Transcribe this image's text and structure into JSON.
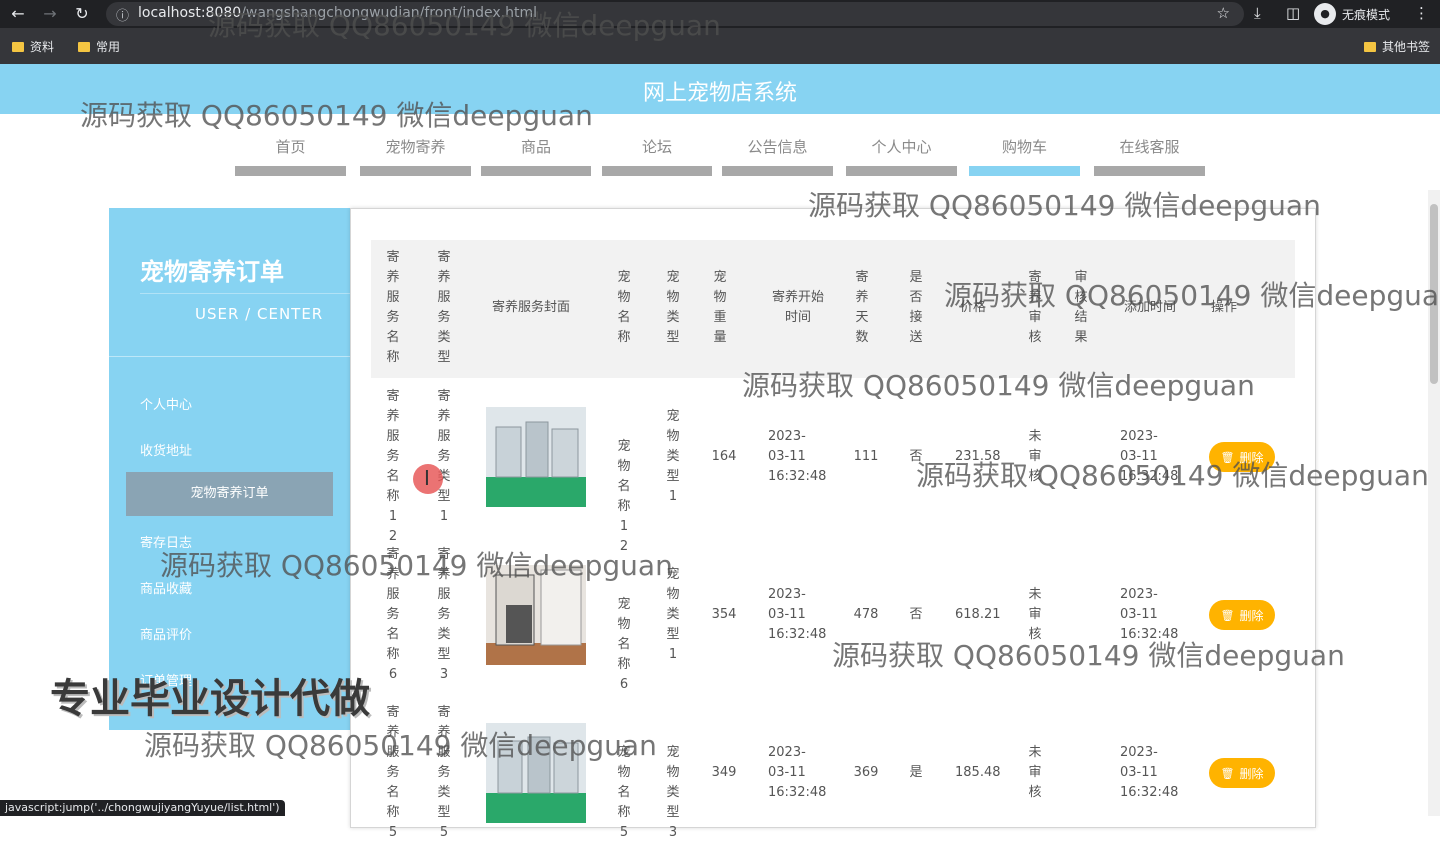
{
  "browser": {
    "url_host": "localhost:8080",
    "url_path": "/wangshangchongwudian/front/index.html",
    "incognito_label": "无痕模式",
    "bookmarks": [
      "资料",
      "常用"
    ],
    "other_bookmarks": "其他书签",
    "status_url": "javascript:jump('../chongwujiyangYuyue/list.html')"
  },
  "site": {
    "title": "网上宠物店系统",
    "nav": [
      "首页",
      "宠物寄养",
      "商品",
      "论坛",
      "公告信息",
      "个人中心",
      "购物车",
      "在线客服"
    ],
    "active_nav": "购物车"
  },
  "sidebar": {
    "title": "宠物寄养订单",
    "subtitle": "USER / CENTER",
    "items": [
      "个人中心",
      "收货地址",
      "宠物寄养订单",
      "寄存日志",
      "商品收藏",
      "商品评价",
      "订单管理"
    ],
    "active_item": "宠物寄养订单"
  },
  "table": {
    "headers": [
      "寄养服务名称",
      "寄养服务类型",
      "寄养服务封面",
      "宠物名称",
      "宠物类型",
      "宠物重量",
      "寄养开始时间",
      "寄养天数",
      "是否接送",
      "价格",
      "寄养审核",
      "审核结果",
      "添加时间",
      "操作"
    ],
    "rows": [
      {
        "service_name": "寄养服务名称12",
        "service_type": "寄养服务类型1",
        "pet_name": "宠物名称12",
        "pet_type": "宠物类型1",
        "weight": "164",
        "start_time": "2023-03-11 16:32:48",
        "days": "111",
        "pickup": "否",
        "price": "231.58",
        "audit": "未审核",
        "result": "",
        "added": "2023-03-11 16:32:48",
        "action": "删除"
      },
      {
        "service_name": "寄养服务名称6",
        "service_type": "寄养服务类型3",
        "pet_name": "宠物名称6",
        "pet_type": "宠物类型1",
        "weight": "354",
        "start_time": "2023-03-11 16:32:48",
        "days": "478",
        "pickup": "否",
        "price": "618.21",
        "audit": "未审核",
        "result": "",
        "added": "2023-03-11 16:32:48",
        "action": "删除"
      },
      {
        "service_name": "寄养服务名称5",
        "service_type": "寄养服务类型5",
        "pet_name": "宠物名称5",
        "pet_type": "宠物类型3",
        "weight": "349",
        "start_time": "2023-03-11 16:32:48",
        "days": "369",
        "pickup": "是",
        "price": "185.48",
        "audit": "未审核",
        "result": "",
        "added": "2023-03-11 16:32:48",
        "action": "删除"
      }
    ]
  },
  "watermarks": {
    "repeat_text": "源码获取 QQ86050149 微信deepguan",
    "banner_text": "专业毕业设计代做"
  },
  "colors": {
    "header_blue": "#87d3f2",
    "delete_yellow": "#ffb300",
    "sidebar_active": "#8aa4b4"
  }
}
